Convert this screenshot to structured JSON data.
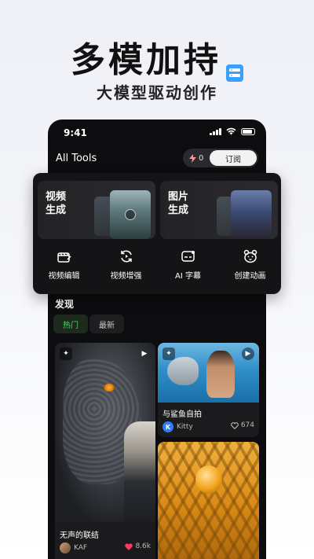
{
  "hero": {
    "title": "多模加持",
    "subtitle": "大模型驱动创作"
  },
  "status_bar": {
    "time": "9:41",
    "icons": [
      "signal-icon",
      "wifi-icon",
      "battery-icon"
    ]
  },
  "header": {
    "title": "All Tools",
    "credits_count": "0",
    "subscribe_label": "订阅"
  },
  "features": [
    {
      "label_line1": "视频",
      "label_line2": "生成",
      "icon": "video-thumbnail"
    },
    {
      "label_line1": "图片",
      "label_line2": "生成",
      "icon": "image-thumbnail"
    }
  ],
  "tools": [
    {
      "label": "视频编辑",
      "icon": "clapper-edit-icon"
    },
    {
      "label": "视频增强",
      "icon": "refresh-enhance-icon"
    },
    {
      "label": "AI 字幕",
      "icon": "subtitle-icon"
    },
    {
      "label": "创建动画",
      "icon": "bear-icon"
    }
  ],
  "discover": {
    "title": "发现",
    "tabs": [
      {
        "label": "热门",
        "active": true
      },
      {
        "label": "最新",
        "active": false
      }
    ]
  },
  "posts": [
    {
      "title": "无声的联结",
      "author": "KAF",
      "likes": "8.6k",
      "liked": true
    },
    {
      "title": "与鲨鱼自拍",
      "author": "Kitty",
      "author_initial": "K",
      "likes": "674",
      "liked": false
    }
  ],
  "colors": {
    "accent_green": "#4cd964",
    "like_red": "#ff3b5c",
    "avatar_blue": "#2f7cf6",
    "badge_blue": "#3aa0ff"
  }
}
